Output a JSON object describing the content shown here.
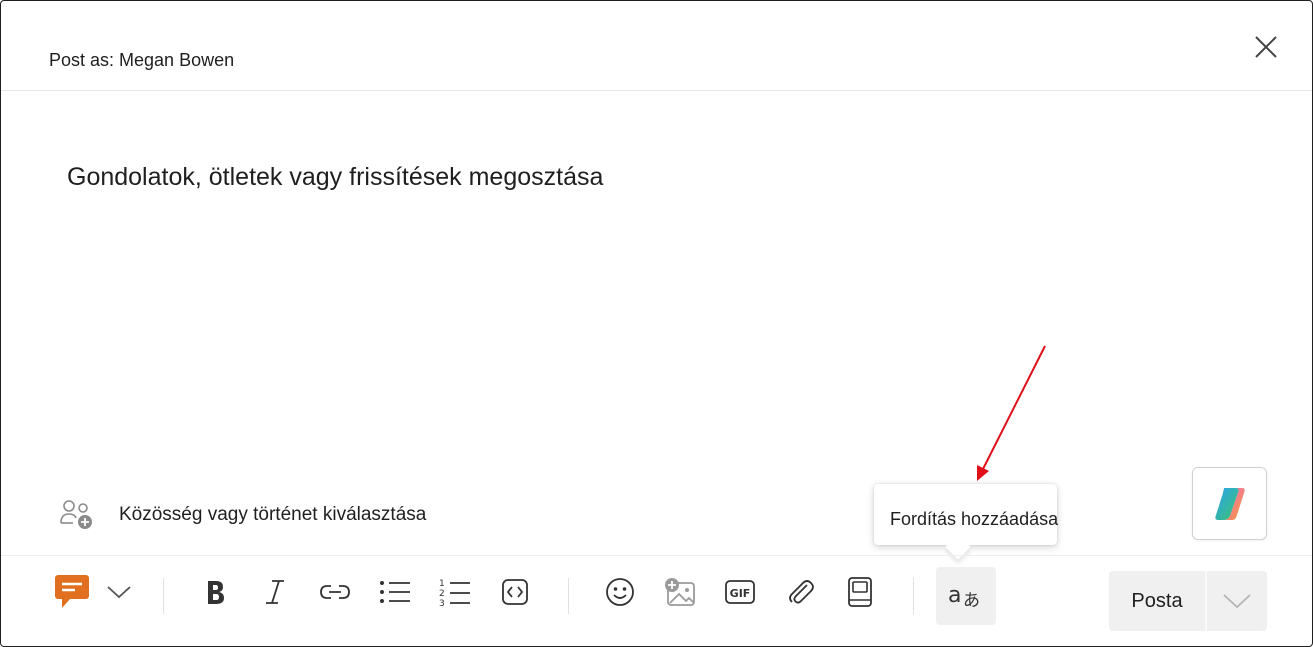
{
  "header": {
    "post_as": "Post as: Megan Bowen",
    "close_icon": "close-icon"
  },
  "composer": {
    "placeholder": "Gondolatok, ötletek vagy frissítések megosztása"
  },
  "community": {
    "label": "Közösség vagy történet kiválasztása",
    "icon": "people-add-icon"
  },
  "copilot": {
    "icon": "copilot-icon"
  },
  "tooltip": {
    "text": "Fordítás hozzáadása"
  },
  "toolbar": {
    "items": [
      "message-type-icon",
      "chevron-down-icon",
      "bold-icon",
      "italic-icon",
      "link-icon",
      "bulleted-list-icon",
      "numbered-list-icon",
      "code-icon",
      "emoji-icon",
      "image-add-icon",
      "gif-icon",
      "attach-icon",
      "book-icon",
      "translate-icon"
    ],
    "post_label": "Posta"
  },
  "colors": {
    "accent_orange": "#e0701f",
    "annotation_arrow": "#e0101a",
    "button_bg": "#f0f0f0"
  }
}
